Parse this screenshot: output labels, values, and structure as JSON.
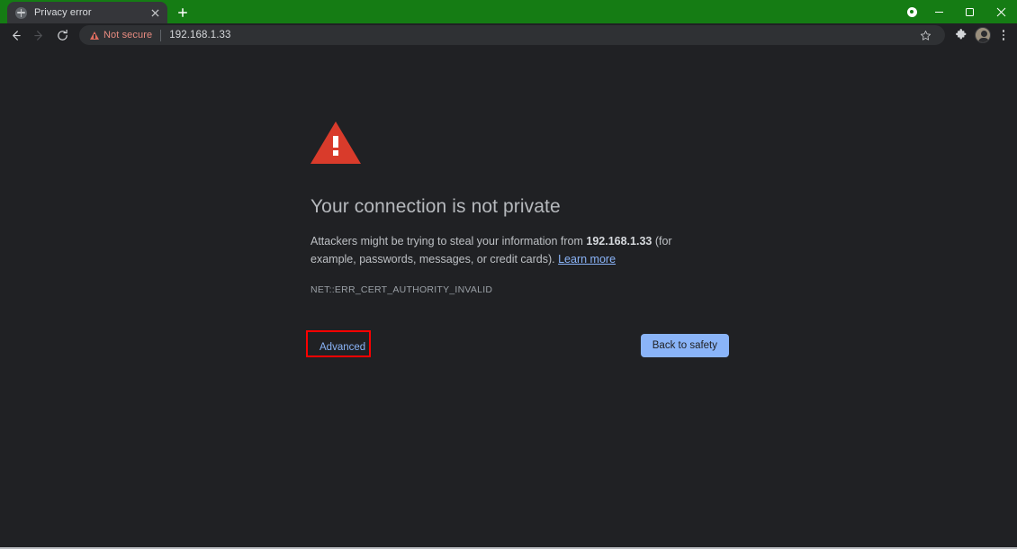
{
  "browser": {
    "tab": {
      "title": "Privacy error",
      "favicon_icon": "globe-icon",
      "close_icon": "close-icon"
    },
    "new_tab_icon": "plus-icon",
    "window_controls": {
      "update_icon": "update-indicator-icon",
      "minimize_icon": "minimize-icon",
      "maximize_icon": "maximize-icon",
      "close_icon": "window-close-icon"
    },
    "toolbar": {
      "back_icon": "back-arrow-icon",
      "forward_icon": "forward-arrow-icon",
      "reload_icon": "reload-icon",
      "security_label": "Not secure",
      "security_icon": "warning-triangle-icon",
      "url": "192.168.1.33",
      "bookmark_icon": "star-icon",
      "extensions_icon": "puzzle-piece-icon",
      "profile_icon": "avatar-icon",
      "menu_icon": "kebab-menu-icon"
    },
    "colors": {
      "tabstrip_green": "#157c14",
      "active_tab": "#35363a",
      "chrome_dark": "#202124",
      "omnibox": "#2f3134",
      "link_blue": "#8ab4f8",
      "error_red": "#d93b2b",
      "not_secure_red": "#e78b80",
      "highlight_red": "#fe0000"
    }
  },
  "interstitial": {
    "icon": "error-warning-triangle-icon",
    "heading": "Your connection is not private",
    "body_part1": "Attackers might be trying to steal your information from ",
    "body_host": "192.168.1.33",
    "body_part2": " (for example, passwords, messages, or credit cards). ",
    "learn_more": "Learn more",
    "error_code": "NET::ERR_CERT_AUTHORITY_INVALID",
    "advanced_label": "Advanced",
    "back_to_safety_label": "Back to safety"
  }
}
